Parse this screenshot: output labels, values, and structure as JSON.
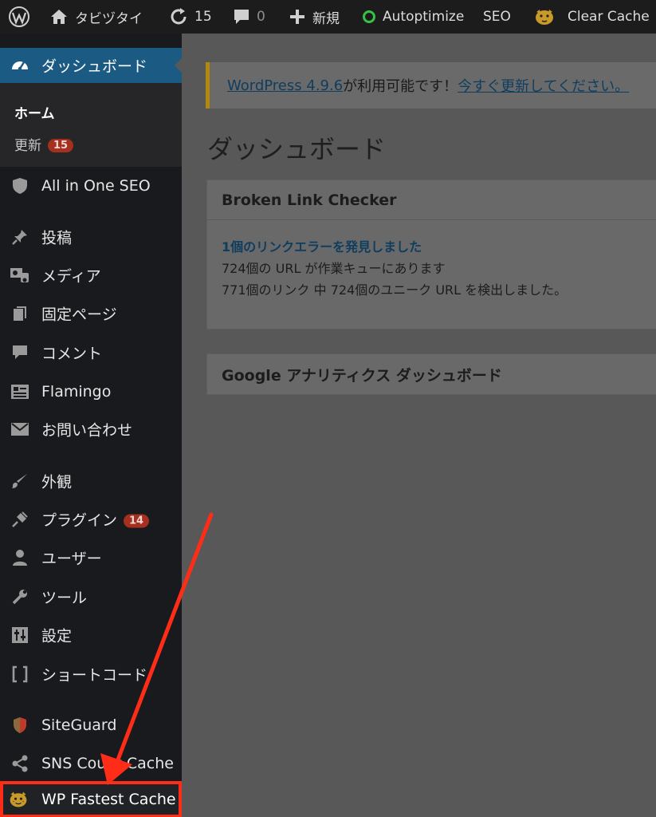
{
  "admin_bar": {
    "site_name": "タビヅタイ",
    "updates_count": "15",
    "comments_count": "0",
    "new_label": "新規",
    "autoptimize_label": "Autoptimize",
    "seo_label": "SEO",
    "clear_cache_label": "Clear Cache"
  },
  "sidebar": {
    "dashboard": "ダッシュボード",
    "submenu": {
      "home": "ホーム",
      "updates": "更新",
      "updates_badge": "15"
    },
    "items": [
      {
        "label": "All in One SEO",
        "icon": "shield-icon"
      },
      {
        "label": "投稿",
        "icon": "pin-icon"
      },
      {
        "label": "メディア",
        "icon": "media-icon"
      },
      {
        "label": "固定ページ",
        "icon": "pages-icon"
      },
      {
        "label": "コメント",
        "icon": "comment-icon"
      },
      {
        "label": "Flamingo",
        "icon": "flamingo-icon"
      },
      {
        "label": "お問い合わせ",
        "icon": "mail-icon"
      },
      {
        "label": "外観",
        "icon": "brush-icon"
      },
      {
        "label": "プラグイン",
        "icon": "plugin-icon",
        "badge": "14"
      },
      {
        "label": "ユーザー",
        "icon": "user-icon"
      },
      {
        "label": "ツール",
        "icon": "wrench-icon"
      },
      {
        "label": "設定",
        "icon": "settings-icon"
      },
      {
        "label": "ショートコード",
        "icon": "brackets-icon"
      },
      {
        "label": "SiteGuard",
        "icon": "siteguard-icon"
      },
      {
        "label": "SNS Count Cache",
        "icon": "share-icon"
      },
      {
        "label": "WP Fastest Cache",
        "icon": "cheetah-icon"
      }
    ]
  },
  "main": {
    "notice": {
      "version_link": "WordPress 4.9.6",
      "middle_text": " が利用可能です！",
      "update_link": "今すぐ更新してください。"
    },
    "page_title": "ダッシュボード",
    "broken_link_checker": {
      "title": "Broken Link Checker",
      "error_line": "1個のリンクエラーを発見しました",
      "queue_line": "724個の URL が作業キューにあります",
      "found_line": "771個のリンク 中 724個のユニーク URL を検出しました。"
    },
    "google_analytics": {
      "title": "Google アナリティクス ダッシュボード"
    }
  },
  "colors": {
    "admin_bar_bg": "#1c1c1d",
    "sidebar_bg": "#181a1d",
    "dashboard_active": "#1b5a83",
    "badge_bg": "#a5301f",
    "highlight_red": "#ff2d17",
    "notice_border": "#b3890d"
  }
}
